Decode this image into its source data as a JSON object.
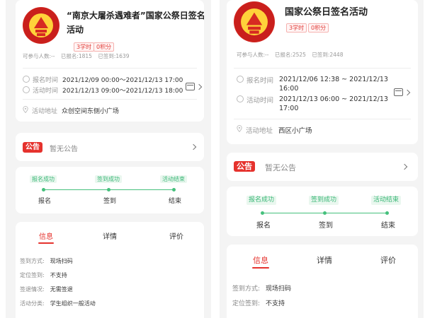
{
  "left": {
    "title_line1": "“南京大屠杀遇难者”国家公祭日签名",
    "title_line2": "活动",
    "tag_hours": "3学时",
    "tag_points": "0积分",
    "stat_participants": "可参与人数:--",
    "stat_signed": "已报名:1815",
    "stat_checked": "已签到:1639",
    "register_label": "报名时间",
    "register_value": "2021/12/09 00:00～2021/12/13 17:00",
    "activity_label": "活动时间",
    "activity_value": "2021/12/13 09:00～2021/12/13 18:00",
    "address_label": "活动地址",
    "address_value": "众创空间东侧小广场",
    "notice_badge": "公告",
    "notice_text": "暂无公告",
    "steps": [
      {
        "status": "报名成功",
        "name": "报名"
      },
      {
        "status": "签到成功",
        "name": "签到"
      },
      {
        "status": "活动结束",
        "name": "结束"
      }
    ],
    "tabs": [
      "信息",
      "详情",
      "评价"
    ],
    "info": [
      {
        "k": "签到方式:",
        "v": "现场扫码"
      },
      {
        "k": "定位签到:",
        "v": "不支持"
      },
      {
        "k": "签退情况:",
        "v": "无需签退"
      },
      {
        "k": "活动分类:",
        "v": "学生组织一般活动"
      }
    ]
  },
  "right": {
    "title_line1": "国家公祭日签名活动",
    "tag_hours": "3学时",
    "tag_points": "0积分",
    "stat_participants": "可参与人数:--",
    "stat_signed": "已报名:2525",
    "stat_checked": "已签到:2448",
    "register_label": "报名时间",
    "register_value_1": "2021/12/06 12:38 ~ 2021/12/13",
    "register_value_2": "16:00",
    "activity_label": "活动时间",
    "activity_value_1": "2021/12/13 06:00 ~ 2021/12/13",
    "activity_value_2": "17:00",
    "address_label": "活动地址",
    "address_value": "西区小广场",
    "notice_badge": "公告",
    "notice_text": "暂无公告",
    "steps": [
      {
        "status": "报名成功",
        "name": "报名"
      },
      {
        "status": "签到成功",
        "name": "签到"
      },
      {
        "status": "活动结束",
        "name": "结束"
      }
    ],
    "tabs": [
      "信息",
      "详情",
      "评价"
    ],
    "info": [
      {
        "k": "签到方式:",
        "v": "现场扫码"
      },
      {
        "k": "定位签到:",
        "v": "不支持"
      }
    ]
  },
  "colors": {
    "accent_red": "#e5322d",
    "step_green": "#45c07c",
    "logo_gold": "#ffd23a",
    "logo_red": "#c91f1c"
  }
}
